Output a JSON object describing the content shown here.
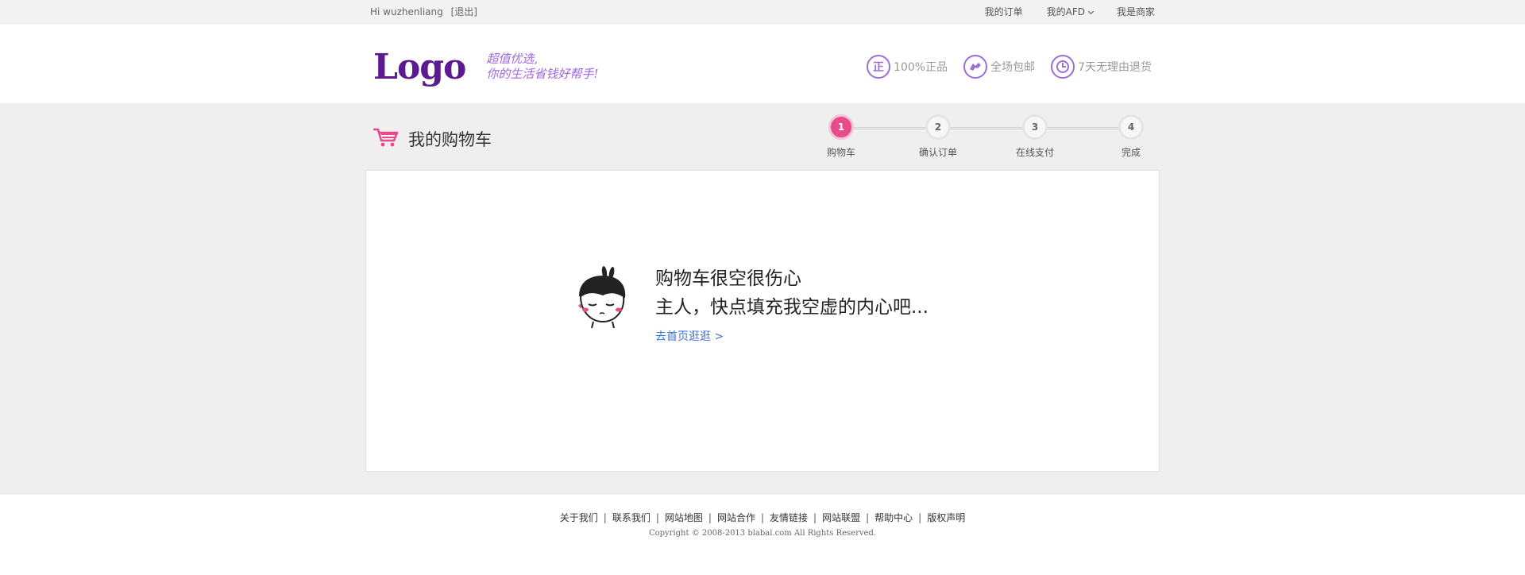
{
  "topbar": {
    "greeting": "Hi wuzhenliang",
    "logout": "[退出]",
    "links": {
      "orders": "我的订单",
      "my_afd": "我的AFD",
      "merchant": "我是商家"
    }
  },
  "header": {
    "logo": "Logo",
    "slogan_line1": "超值优选,",
    "slogan_line2": "你的生活省钱好帮手!",
    "promises": [
      {
        "icon": "genuine-icon",
        "glyph": "正",
        "label": "100%正品"
      },
      {
        "icon": "free-shipping-icon",
        "label": "全场包邮"
      },
      {
        "icon": "clock-return-icon",
        "label": "7天无理由退货"
      }
    ]
  },
  "cart": {
    "title": "我的购物车",
    "steps": [
      {
        "num": "1",
        "label": "购物车",
        "active": true
      },
      {
        "num": "2",
        "label": "确认订单",
        "active": false
      },
      {
        "num": "3",
        "label": "在线支付",
        "active": false
      },
      {
        "num": "4",
        "label": "完成",
        "active": false
      }
    ],
    "empty_line1": "购物车很空很伤心",
    "empty_line2": "主人，快点填充我空虚的内心吧...",
    "go_home": "去首页逛逛 >"
  },
  "footer": {
    "links": [
      "关于我们",
      "联系我们",
      "网站地图",
      "网站合作",
      "友情链接",
      "网站联盟",
      "帮助中心",
      "版权声明"
    ],
    "copyright": "Copyright © 2008-2013 blabal.com All Rights Reserved."
  },
  "colors": {
    "brand_purple": "#5b1a90",
    "accent_pink": "#e84a8a",
    "link_blue": "#3b77d8",
    "icon_purple": "#9b6fd6"
  }
}
